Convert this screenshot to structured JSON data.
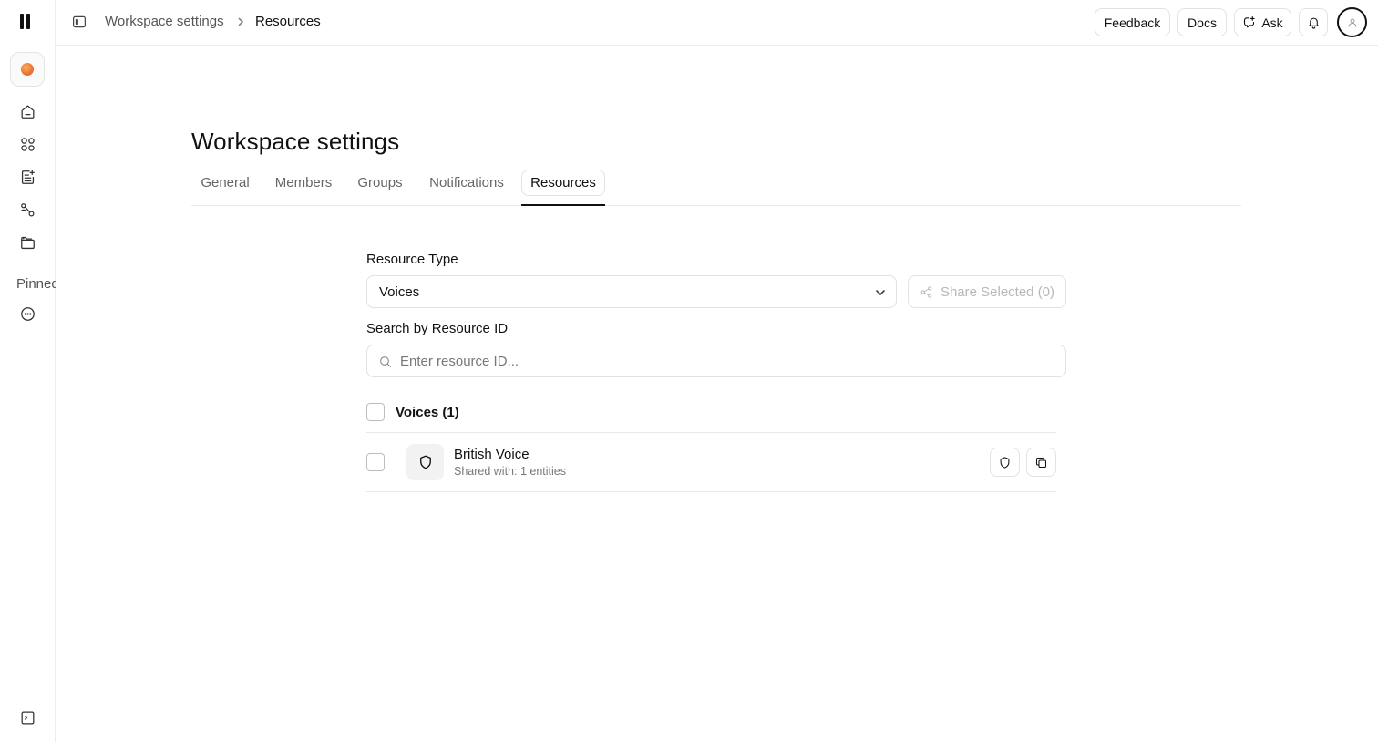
{
  "rail": {
    "icons": [
      "logo-icon",
      "workspace-avatar",
      "home-icon",
      "apps-icon",
      "notes-icon",
      "flows-icon",
      "folder-icon",
      "more-icon",
      "terminal-icon"
    ],
    "pinned_label": "Pinned"
  },
  "topbar": {
    "breadcrumb": [
      "Workspace settings",
      "Resources"
    ],
    "feedback_label": "Feedback",
    "docs_label": "Docs",
    "ask_label": "Ask"
  },
  "page": {
    "title": "Workspace settings",
    "tabs": [
      {
        "label": "General",
        "active": false
      },
      {
        "label": "Members",
        "active": false
      },
      {
        "label": "Groups",
        "active": false
      },
      {
        "label": "Notifications",
        "active": false
      },
      {
        "label": "Resources",
        "active": true
      }
    ]
  },
  "form": {
    "resource_type_label": "Resource Type",
    "resource_type_value": "Voices",
    "share_button_label": "Share Selected (0)",
    "search_label": "Search by Resource ID",
    "search_placeholder": "Enter resource ID...",
    "search_value": ""
  },
  "resources": {
    "group_title": "Voices (1)",
    "items": [
      {
        "name": "British Voice",
        "meta": "Shared with: 1 entities"
      }
    ]
  },
  "colors": {
    "text": "#111111",
    "muted": "#777777",
    "border": "#e2e2e2",
    "disabled": "#b8b8b8"
  }
}
